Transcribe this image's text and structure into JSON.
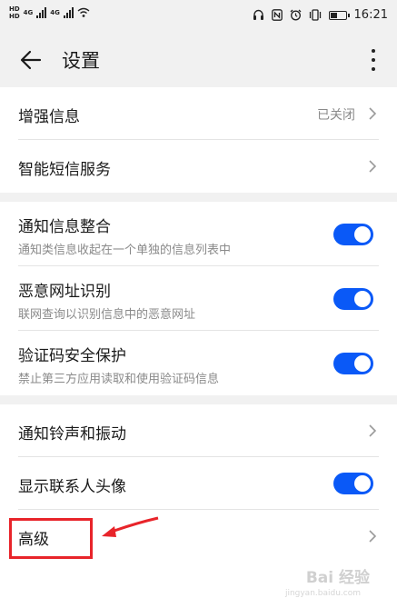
{
  "status": {
    "sim1_label": "HD",
    "sim2_label": "HD",
    "net1": "4G",
    "net2": "4G",
    "battery_level": 0.5,
    "time": "16:21",
    "icons": [
      "headset-icon",
      "nfc-icon",
      "alarm-icon",
      "vibrate-icon",
      "battery-icon"
    ]
  },
  "appbar": {
    "title": "设置"
  },
  "section1": {
    "items": [
      {
        "label": "增强信息",
        "value": "已关闭"
      },
      {
        "label": "智能短信服务"
      }
    ]
  },
  "section2": {
    "items": [
      {
        "label": "通知信息整合",
        "sub": "通知类信息收起在一个单独的信息列表中",
        "toggle": true
      },
      {
        "label": "恶意网址识别",
        "sub": "联网查询以识别信息中的恶意网址",
        "toggle": true
      },
      {
        "label": "验证码安全保护",
        "sub": "禁止第三方应用读取和使用验证码信息",
        "toggle": true
      }
    ]
  },
  "section3": {
    "items": [
      {
        "label": "通知铃声和振动"
      },
      {
        "label": "显示联系人头像",
        "toggle": true
      },
      {
        "label": "高级"
      }
    ]
  },
  "colors": {
    "accent": "#0a59f7",
    "annotation": "#e8242a",
    "background": "#f1f1f1"
  },
  "watermark": {
    "text": "Bai 经验",
    "sub": "jingyan.baidu.com"
  }
}
